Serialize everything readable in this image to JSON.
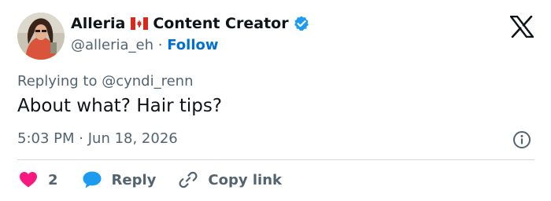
{
  "author": {
    "name": "Alleria",
    "role": "Content Creator",
    "flag": "canada-flag",
    "verified_icon": "verified-badge-icon",
    "handle": "@alleria_eh",
    "separator": "·",
    "follow_label": "Follow"
  },
  "reply": {
    "prefix": "Replying to",
    "mention": "@cyndi_renn"
  },
  "tweet": {
    "text": "About what? Hair tips?",
    "time": "5:03 PM",
    "separator": "·",
    "date": "Jun 18, 2026"
  },
  "actions": {
    "like_count": "2",
    "reply_label": "Reply",
    "copy_label": "Copy link"
  },
  "colors": {
    "accent": "#1d9bf0",
    "link": "#006fd6",
    "like": "#f91880",
    "muted": "#536471",
    "text": "#0f1419",
    "flag_red": "#d52b1e"
  },
  "icons": [
    "x-logo-icon",
    "verified-badge-icon",
    "info-icon",
    "heart-icon",
    "reply-bubble-icon",
    "link-icon"
  ]
}
